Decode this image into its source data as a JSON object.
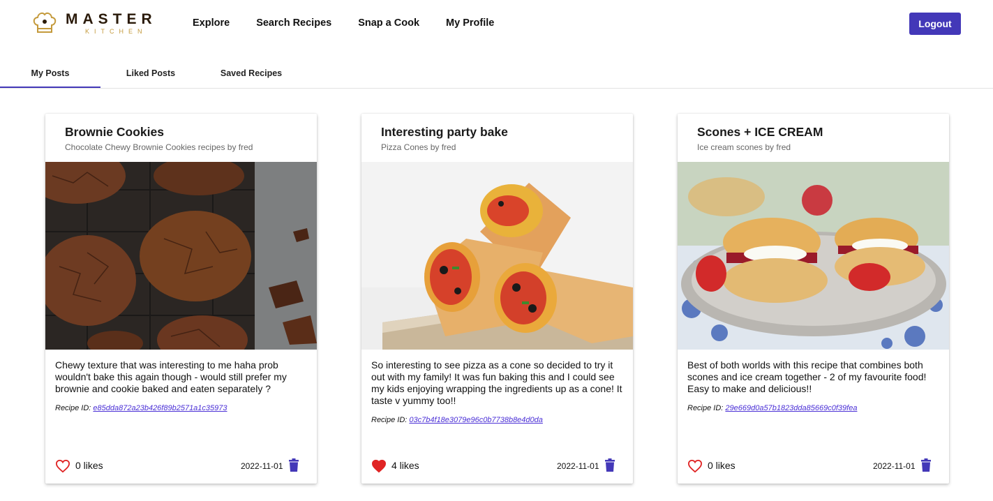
{
  "brand": {
    "name": "MASTER",
    "sub": "KITCHEN",
    "colors": {
      "dark": "#2a1a0a",
      "gold": "#c49a3c"
    }
  },
  "nav": {
    "items": [
      {
        "label": "Explore"
      },
      {
        "label": "Search Recipes"
      },
      {
        "label": "Snap a Cook"
      },
      {
        "label": "My Profile"
      }
    ],
    "logout_label": "Logout"
  },
  "tabs": [
    {
      "label": "My Posts",
      "active": true
    },
    {
      "label": "Liked Posts",
      "active": false
    },
    {
      "label": "Saved Recipes",
      "active": false
    }
  ],
  "accent_color": "#4338b8",
  "posts": [
    {
      "title": "Brownie Cookies",
      "subtitle": "Chocolate Chewy Brownie Cookies recipes by fred",
      "image": "brownie-cookies-photo",
      "text": "Chewy texture that was interesting to me haha prob wouldn't bake this again though - would still prefer my brownie and cookie baked and eaten separately ?",
      "recipe_id_label": "Recipe ID:",
      "recipe_id": "e85dda872a23b426f89b2571a1c35973",
      "liked": false,
      "likes": "0 likes",
      "date": "2022-11-01"
    },
    {
      "title": "Interesting party bake",
      "subtitle": "Pizza Cones by fred",
      "image": "pizza-cones-photo",
      "text": "So interesting to see pizza as a cone so decided to try it out with my family! It was fun baking this and I could see my kids enjoying wrapping the ingredients up as a cone! It taste v yummy too!!",
      "recipe_id_label": "Recipe ID:",
      "recipe_id": "03c7b4f18e3079e96c0b7738b8e4d0da",
      "liked": true,
      "likes": "4 likes",
      "date": "2022-11-01"
    },
    {
      "title": "Scones + ICE CREAM",
      "subtitle": "Ice cream scones by fred",
      "image": "scones-photo",
      "text": "Best of both worlds with this recipe that combines both scones and ice cream together - 2 of my favourite food! Easy to make and delicious!!",
      "recipe_id_label": "Recipe ID:",
      "recipe_id": "29e669d0a57b1823dda85669c0f39fea",
      "liked": false,
      "likes": "0 likes",
      "date": "2022-11-01"
    }
  ],
  "icons": {
    "like": "heart-icon",
    "delete": "trash-icon",
    "heart_color": "#e02424"
  }
}
